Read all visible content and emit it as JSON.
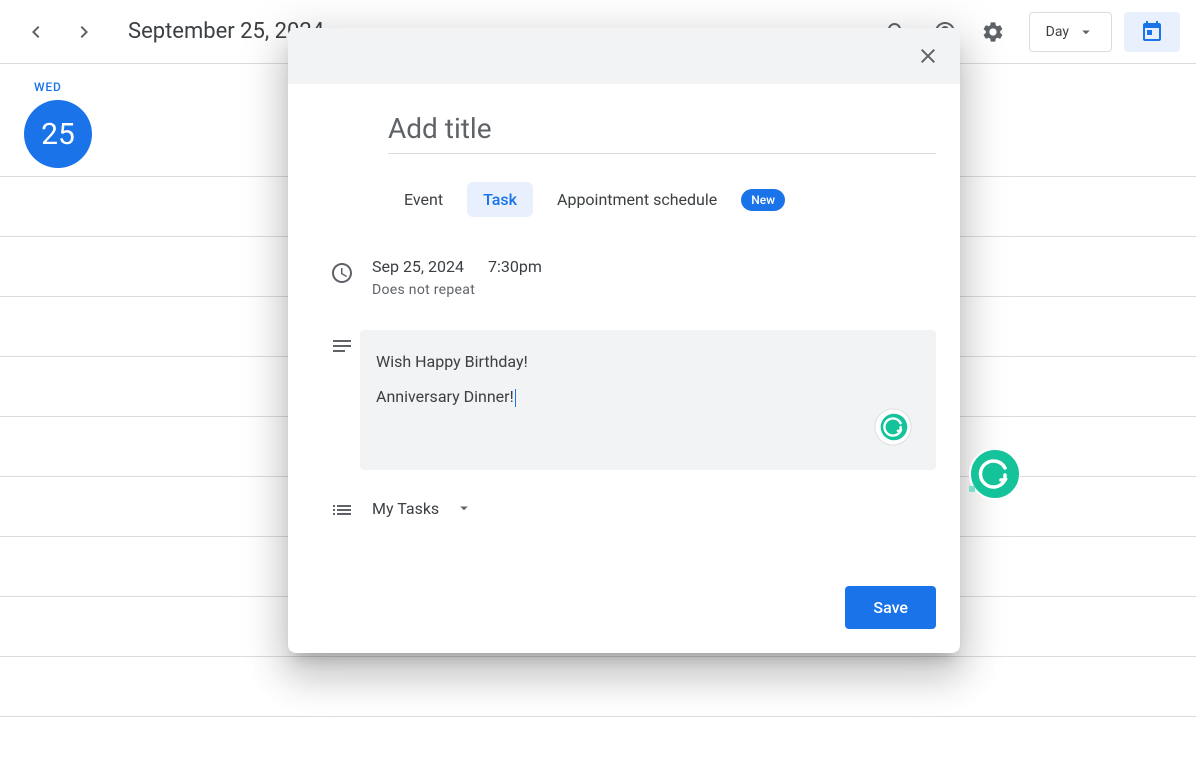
{
  "header": {
    "title": "September 25, 2024",
    "view_label": "Day"
  },
  "day": {
    "weekday": "WED",
    "number": "25"
  },
  "modal": {
    "title_placeholder": "Add title",
    "title_value": "",
    "tabs": {
      "event": "Event",
      "task": "Task",
      "appointment": "Appointment schedule",
      "new_badge": "New"
    },
    "date": "Sep 25, 2024",
    "time": "7:30pm",
    "repeat": "Does not repeat",
    "description": "Wish Happy Birthday!\nAnniversary Dinner!",
    "description_line1": "Wish Happy Birthday!",
    "description_line2": "Anniversary Dinner!",
    "task_list": "My Tasks",
    "save_label": "Save"
  }
}
